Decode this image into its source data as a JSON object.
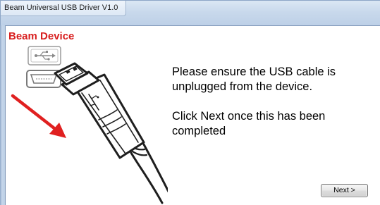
{
  "window": {
    "title": "Beam Universal USB Driver V1.0"
  },
  "brand": {
    "label": "Beam Device",
    "color": "#d81f1f"
  },
  "illustration": {
    "icons": [
      "usb-a-port-icon",
      "mini-usb-port-icon",
      "mini-usb-cable-icon",
      "red-arrow-icon"
    ],
    "arrow_color": "#e02020"
  },
  "message": {
    "line1": "Please ensure the USB cable is unplugged from the device.",
    "line2": "Click Next once this has been completed"
  },
  "buttons": {
    "next_label": "Next >"
  }
}
